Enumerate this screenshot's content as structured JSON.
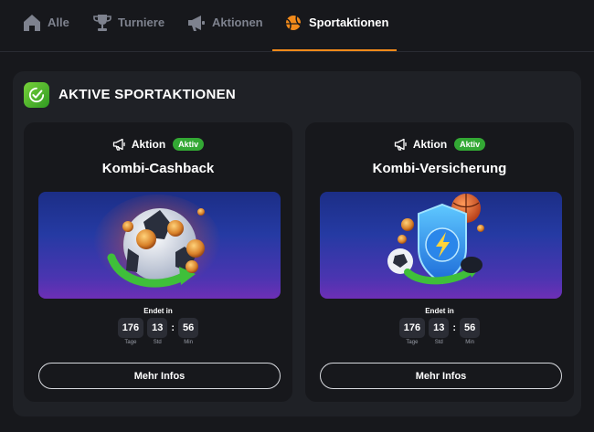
{
  "tabs": [
    {
      "label": "Alle",
      "icon": "home-icon",
      "active": false
    },
    {
      "label": "Turniere",
      "icon": "trophy-icon",
      "active": false
    },
    {
      "label": "Aktionen",
      "icon": "megaphone-icon",
      "active": false
    },
    {
      "label": "Sportaktionen",
      "icon": "sports-ball-icon",
      "active": true
    }
  ],
  "section": {
    "title": "AKTIVE SPORTAKTIONEN",
    "icon": "check-badge-icon"
  },
  "cards": [
    {
      "type_label": "Aktion",
      "badge": "Aktiv",
      "title": "Kombi-Cashback",
      "ends_label": "Endet in",
      "countdown": [
        {
          "value": "176",
          "unit": "Tage"
        },
        {
          "value": "13",
          "unit": "Std"
        },
        {
          "value": "56",
          "unit": "Min"
        }
      ],
      "button": "Mehr Infos"
    },
    {
      "type_label": "Aktion",
      "badge": "Aktiv",
      "title": "Kombi-Versicherung",
      "ends_label": "Endet in",
      "countdown": [
        {
          "value": "176",
          "unit": "Tage"
        },
        {
          "value": "13",
          "unit": "Std"
        },
        {
          "value": "56",
          "unit": "Min"
        }
      ],
      "button": "Mehr Infos"
    }
  ],
  "colors": {
    "accent": "#f28a1a",
    "badge_green": "#33a834",
    "background": "#17181c",
    "panel": "#1f2126"
  }
}
